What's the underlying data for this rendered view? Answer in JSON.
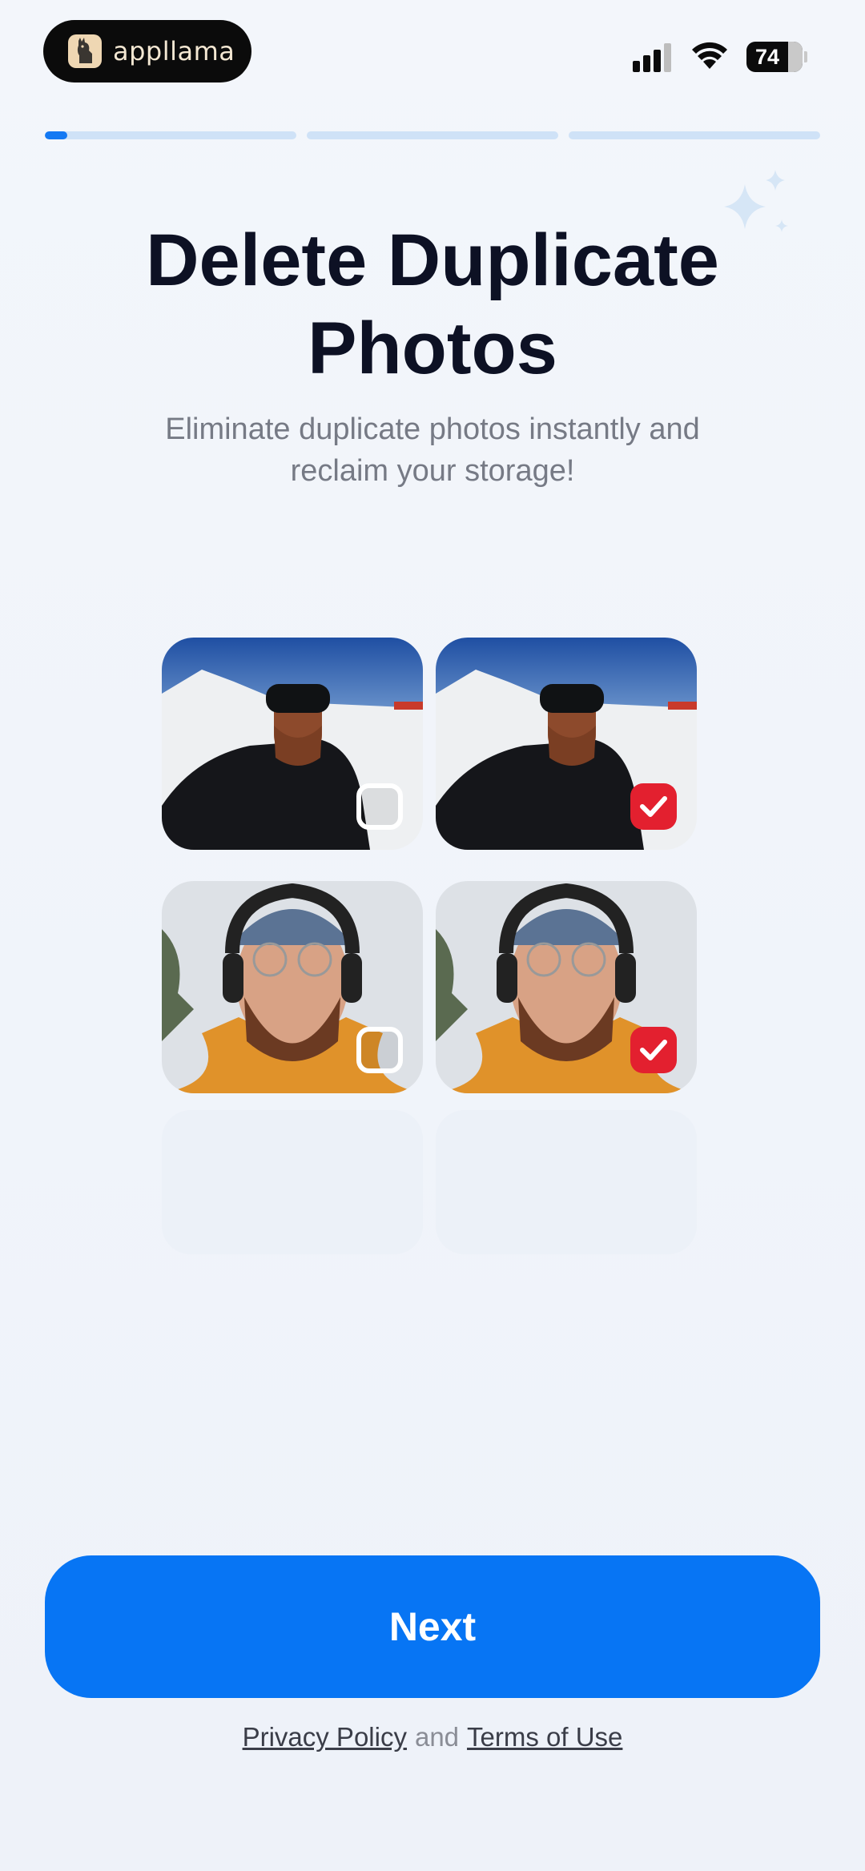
{
  "status_bar": {
    "brand_name": "appllama",
    "battery_level": "74",
    "signal_bars": 3,
    "icons": [
      "signal-icon",
      "wifi-icon",
      "battery-icon"
    ]
  },
  "progress": {
    "steps": 3,
    "current_step": 1,
    "current_step_fraction": 0.09
  },
  "header": {
    "title": "Delete Duplicate Photos",
    "subtitle": "Eliminate duplicate photos instantly and reclaim your storage!"
  },
  "photos": [
    {
      "scene": "ski-selfie",
      "selected": false
    },
    {
      "scene": "ski-selfie",
      "selected": true
    },
    {
      "scene": "headphones-selfie",
      "selected": false
    },
    {
      "scene": "headphones-selfie",
      "selected": true
    }
  ],
  "actions": {
    "next_label": "Next"
  },
  "footer": {
    "privacy_label": "Privacy Policy",
    "and_text": "and",
    "terms_label": "Terms of Use"
  },
  "colors": {
    "accent": "#0775f4",
    "selected": "#e3202f",
    "title": "#0d1124",
    "subtitle": "#767a85"
  }
}
